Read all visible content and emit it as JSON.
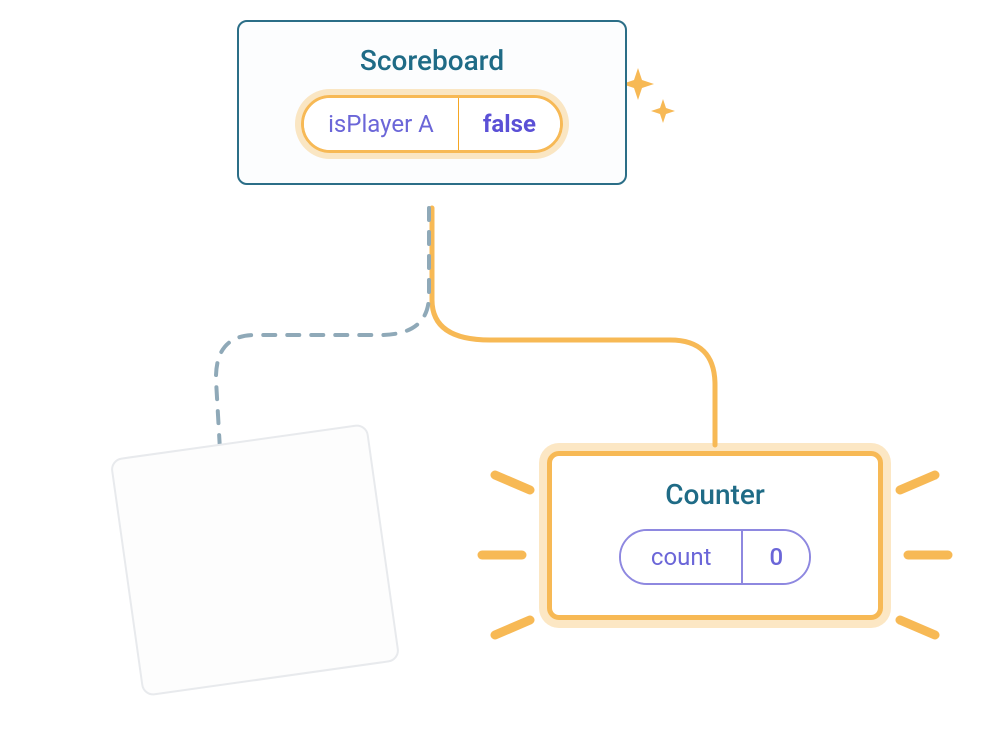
{
  "scoreboard": {
    "title": "Scoreboard",
    "prop_key": "isPlayer A",
    "prop_value": "false"
  },
  "counter": {
    "title": "Counter",
    "state_key": "count",
    "state_value": "0"
  },
  "colors": {
    "gold": "#f7b955",
    "teal": "#1f6b86",
    "purple": "#6b66d8",
    "dashed": "#8fa9b8"
  }
}
